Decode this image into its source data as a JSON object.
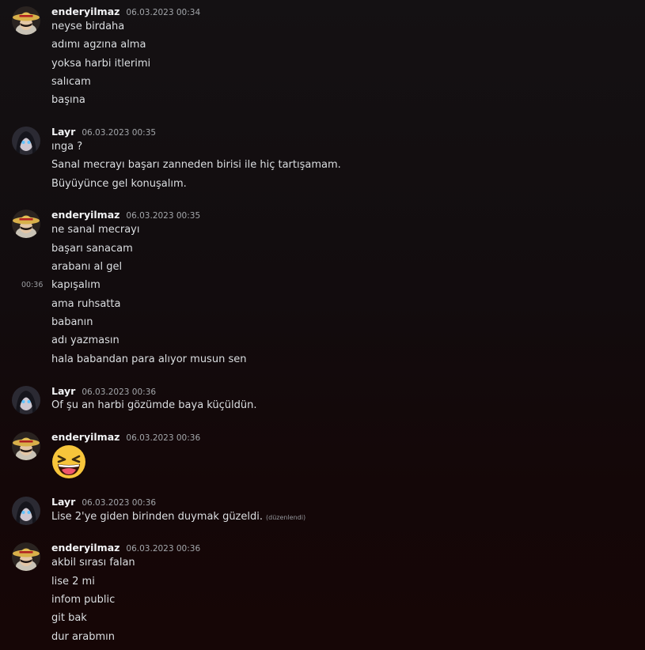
{
  "colors": {
    "username": "#f2f3f5",
    "timestamp": "#a3a6aa",
    "text": "#dbdee1",
    "background_top": "#141113",
    "background_bottom": "#160606"
  },
  "messages": [
    {
      "username": "enderyilmaz",
      "avatar": "straw-hat-avatar",
      "timestamp": "06.03.2023 00:34",
      "lines": [
        "neyse birdaha",
        "adımı agzına alma",
        "yoksa harbi itlerimi",
        "salıcam",
        "başına"
      ]
    },
    {
      "username": "Layr",
      "avatar": "dark-hair-avatar",
      "timestamp": "06.03.2023 00:35",
      "lines": [
        "ınga ?",
        "Sanal mecrayı başarı zanneden birisi ile hiç tartışamam.",
        "Büyüyünce gel konuşalım."
      ]
    },
    {
      "username": "enderyilmaz",
      "avatar": "straw-hat-avatar",
      "timestamp": "06.03.2023 00:35",
      "hover_time": "00:36",
      "lines": [
        "ne sanal mecrayı",
        "başarı sanacam",
        "arabanı al gel",
        "kapışalım",
        "ama ruhsatta",
        "babanın",
        "adı yazmasın",
        "hala babandan para alıyor musun sen"
      ]
    },
    {
      "username": "Layr",
      "avatar": "dark-hair-avatar",
      "timestamp": "06.03.2023 00:36",
      "lines": [
        "Of şu an harbi gözümde baya küçüldün."
      ]
    },
    {
      "username": "enderyilmaz",
      "avatar": "straw-hat-avatar",
      "timestamp": "06.03.2023 00:36",
      "emoji": "laughing-emoji"
    },
    {
      "username": "Layr",
      "avatar": "dark-hair-avatar",
      "timestamp": "06.03.2023 00:36",
      "lines": [
        "Lise 2'ye giden birinden duymak güzeldi."
      ],
      "edited": "(düzenlendi)"
    },
    {
      "username": "enderyilmaz",
      "avatar": "straw-hat-avatar",
      "timestamp": "06.03.2023 00:36",
      "lines": [
        "akbil sırası falan",
        "lise 2 mi",
        "infom public",
        "git bak",
        "dur arabmın"
      ]
    }
  ]
}
